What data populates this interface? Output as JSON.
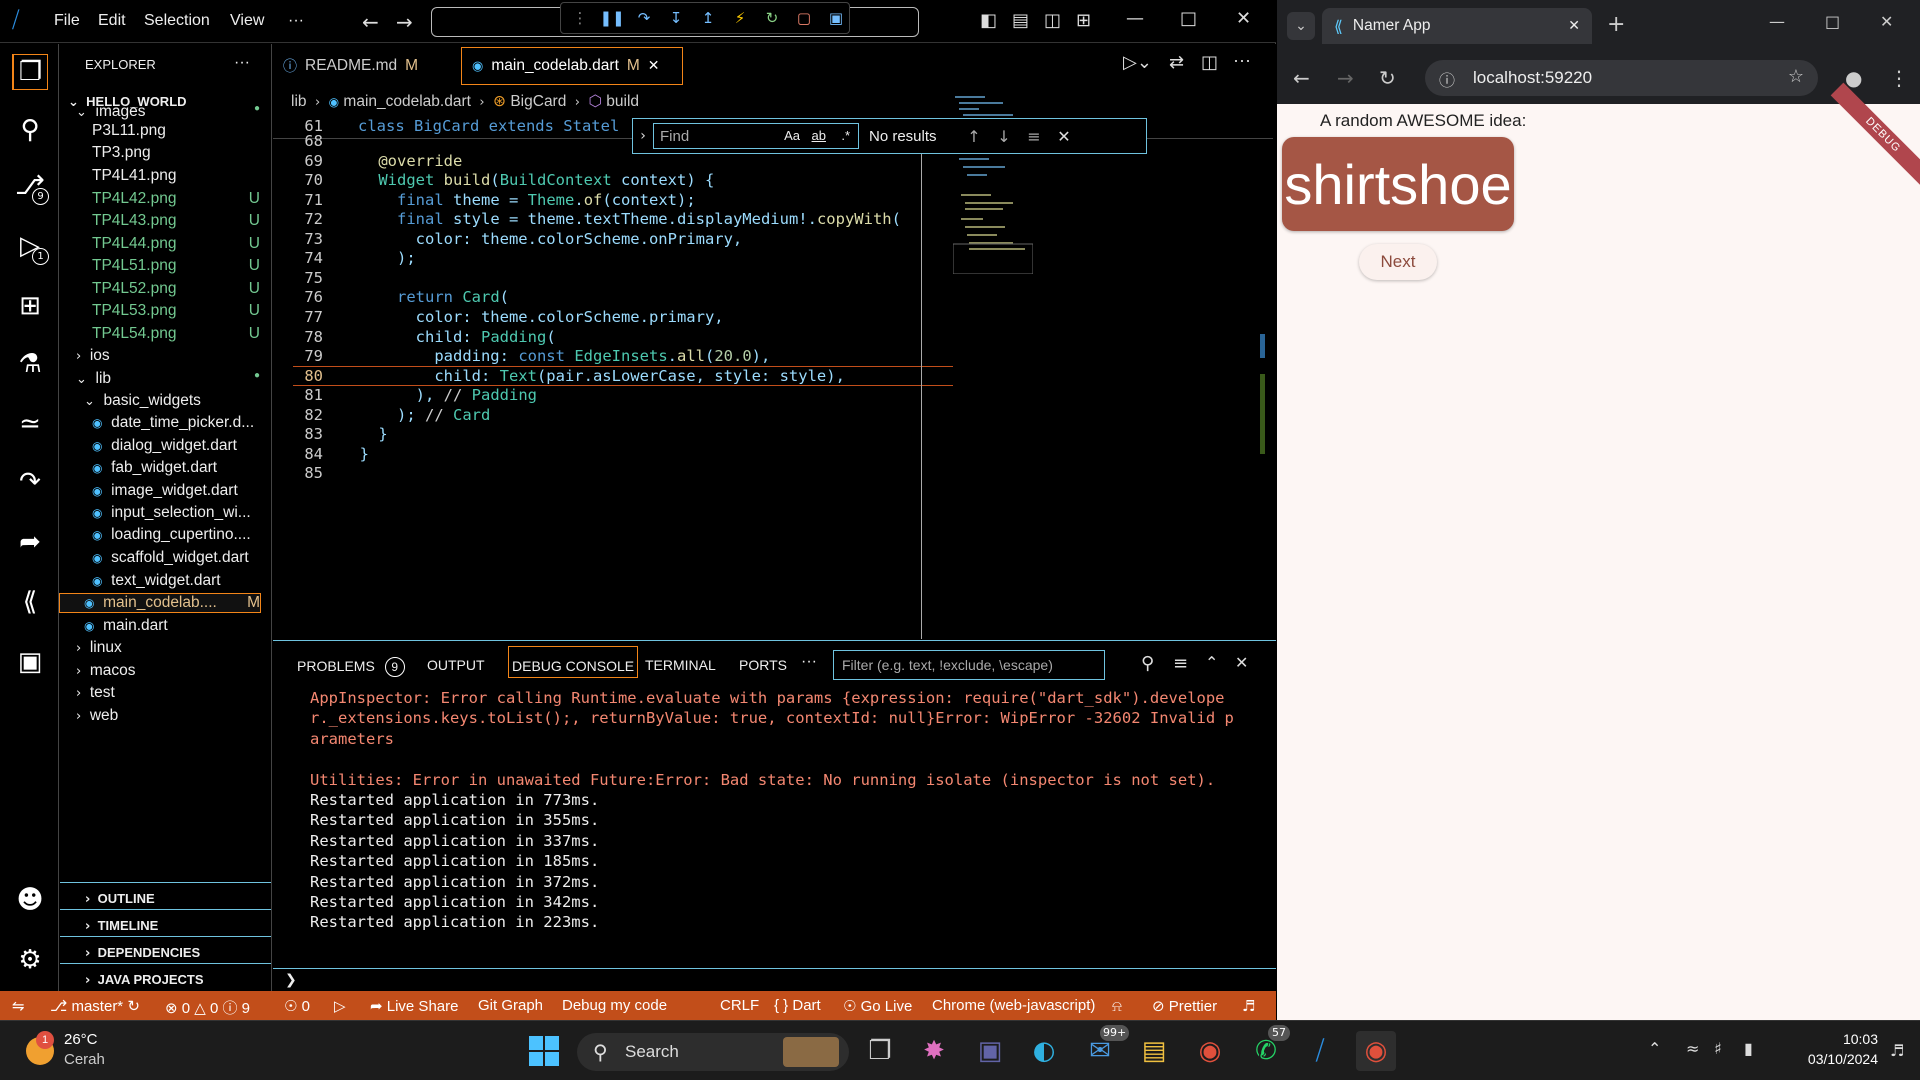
{
  "vscode": {
    "menu": [
      "File",
      "Edit",
      "Selection",
      "View",
      "···"
    ],
    "sidebar": {
      "title": "EXPLORER",
      "root": "HELLO_WORLD",
      "tree": [
        {
          "label": "images",
          "depth": 1,
          "kind": "folder-open",
          "mark": "●"
        },
        {
          "label": "P3L11.png",
          "depth": 2,
          "kind": "file",
          "mark": ""
        },
        {
          "label": "TP3.png",
          "depth": 2,
          "kind": "file",
          "mark": ""
        },
        {
          "label": "TP4L41.png",
          "depth": 2,
          "kind": "file",
          "mark": ""
        },
        {
          "label": "TP4L42.png",
          "depth": 2,
          "kind": "file",
          "mark": "U"
        },
        {
          "label": "TP4L43.png",
          "depth": 2,
          "kind": "file",
          "mark": "U"
        },
        {
          "label": "TP4L44.png",
          "depth": 2,
          "kind": "file",
          "mark": "U"
        },
        {
          "label": "TP4L51.png",
          "depth": 2,
          "kind": "file",
          "mark": "U"
        },
        {
          "label": "TP4L52.png",
          "depth": 2,
          "kind": "file",
          "mark": "U"
        },
        {
          "label": "TP4L53.png",
          "depth": 2,
          "kind": "file",
          "mark": "U"
        },
        {
          "label": "TP4L54.png",
          "depth": 2,
          "kind": "file",
          "mark": "U"
        },
        {
          "label": "ios",
          "depth": 1,
          "kind": "folder",
          "mark": ""
        },
        {
          "label": "lib",
          "depth": 1,
          "kind": "folder-open",
          "mark": "●"
        },
        {
          "label": "basic_widgets",
          "depth": 2,
          "kind": "folder-open",
          "mark": ""
        },
        {
          "label": "date_time_picker.d...",
          "depth": 3,
          "kind": "dart",
          "mark": ""
        },
        {
          "label": "dialog_widget.dart",
          "depth": 3,
          "kind": "dart",
          "mark": ""
        },
        {
          "label": "fab_widget.dart",
          "depth": 3,
          "kind": "dart",
          "mark": ""
        },
        {
          "label": "image_widget.dart",
          "depth": 3,
          "kind": "dart",
          "mark": ""
        },
        {
          "label": "input_selection_wi...",
          "depth": 3,
          "kind": "dart",
          "mark": ""
        },
        {
          "label": "loading_cupertino....",
          "depth": 3,
          "kind": "dart",
          "mark": ""
        },
        {
          "label": "scaffold_widget.dart",
          "depth": 3,
          "kind": "dart",
          "mark": ""
        },
        {
          "label": "text_widget.dart",
          "depth": 3,
          "kind": "dart",
          "mark": ""
        },
        {
          "label": "main_codelab....",
          "depth": 2,
          "kind": "dart",
          "mark": "M"
        },
        {
          "label": "main.dart",
          "depth": 2,
          "kind": "dart",
          "mark": ""
        },
        {
          "label": "linux",
          "depth": 1,
          "kind": "folder",
          "mark": ""
        },
        {
          "label": "macos",
          "depth": 1,
          "kind": "folder",
          "mark": ""
        },
        {
          "label": "test",
          "depth": 1,
          "kind": "folder",
          "mark": ""
        },
        {
          "label": "web",
          "depth": 1,
          "kind": "folder",
          "mark": ""
        }
      ],
      "sections": [
        "OUTLINE",
        "TIMELINE",
        "DEPENDENCIES",
        "JAVA PROJECTS"
      ]
    },
    "tabs": [
      {
        "label": "README.md",
        "mark": "M"
      },
      {
        "label": "main_codelab.dart",
        "mark": "M"
      }
    ],
    "breadcrumb": [
      "lib",
      "main_codelab.dart",
      "BigCard",
      "build"
    ],
    "sticky_line": {
      "num": "61",
      "text": "class BigCard extends Statel"
    },
    "find": {
      "placeholder": "Find",
      "result": "No results",
      "opt1": "Aa",
      "opt2": "ab",
      "opt3": ".*"
    },
    "code_lines": [
      {
        "num": "68",
        "text": ""
      },
      {
        "num": "69",
        "text": "    @override"
      },
      {
        "num": "70",
        "text": "    Widget build(BuildContext context) {"
      },
      {
        "num": "71",
        "text": "      final theme = Theme.of(context);"
      },
      {
        "num": "72",
        "text": "      final style = theme.textTheme.displayMedium!.copyWith("
      },
      {
        "num": "73",
        "text": "        color: theme.colorScheme.onPrimary,"
      },
      {
        "num": "74",
        "text": "      );"
      },
      {
        "num": "75",
        "text": ""
      },
      {
        "num": "76",
        "text": "      return Card("
      },
      {
        "num": "77",
        "text": "        color: theme.colorScheme.primary,"
      },
      {
        "num": "78",
        "text": "        child: Padding("
      },
      {
        "num": "79",
        "text": "          padding: const EdgeInsets.all(20.0),"
      },
      {
        "num": "80",
        "text": "          child: Text(pair.asLowerCase, style: style),"
      },
      {
        "num": "81",
        "text": "        ), // Padding"
      },
      {
        "num": "82",
        "text": "      ); // Card"
      },
      {
        "num": "83",
        "text": "    }"
      },
      {
        "num": "84",
        "text": "  }"
      },
      {
        "num": "85",
        "text": ""
      }
    ],
    "panel": {
      "tabs": [
        "PROBLEMS",
        "OUTPUT",
        "DEBUG CONSOLE",
        "TERMINAL",
        "PORTS",
        "···"
      ],
      "problems_count": "9",
      "filter_placeholder": "Filter (e.g. text, !exclude, \\escape)",
      "console": [
        {
          "text": "AppInspector: Error calling Runtime.evaluate with params {expression: require(\"dart_sdk\").develope",
          "type": "err"
        },
        {
          "text": "r._extensions.keys.toList();, returnByValue: true, contextId: null}Error: WipError -32602 Invalid p",
          "type": "err"
        },
        {
          "text": "arameters",
          "type": "err"
        },
        {
          "text": "",
          "type": "err"
        },
        {
          "text": "Utilities: Error in unawaited Future:Error: Bad state: No running isolate (inspector is not set).",
          "type": "err"
        },
        {
          "text": "Restarted application in 773ms.",
          "type": "out"
        },
        {
          "text": "Restarted application in 355ms.",
          "type": "out"
        },
        {
          "text": "Restarted application in 337ms.",
          "type": "out"
        },
        {
          "text": "Restarted application in 185ms.",
          "type": "out"
        },
        {
          "text": "Restarted application in 372ms.",
          "type": "out"
        },
        {
          "text": "Restarted application in 342ms.",
          "type": "out"
        },
        {
          "text": "Restarted application in 223ms.",
          "type": "out"
        }
      ],
      "prompt": "❯"
    },
    "status": {
      "branch": "master*",
      "errors": "0",
      "warnings": "0",
      "infos": "9",
      "ports": "0",
      "live_share": "Live Share",
      "git_graph": "Git Graph",
      "debug_code": "Debug my code",
      "eol": "CRLF",
      "lang": "Dart",
      "go_live": "Go Live",
      "device": "Chrome (web-javascript)",
      "prettier": "Prettier"
    },
    "activity_badges": {
      "scm": "9",
      "debug": "1"
    }
  },
  "chrome": {
    "tab_title": "Namer App",
    "url": "localhost:59220",
    "app": {
      "heading": "A random AWESOME idea:",
      "word": "shirtshoe",
      "button": "Next",
      "banner": "DEBUG"
    }
  },
  "taskbar": {
    "weather_temp": "26°C",
    "weather_desc": "Cerah",
    "weather_badge": "1",
    "search": "Search",
    "mail_badge": "99+",
    "whatsapp_badge": "57",
    "time": "10:03",
    "date": "03/10/2024"
  }
}
